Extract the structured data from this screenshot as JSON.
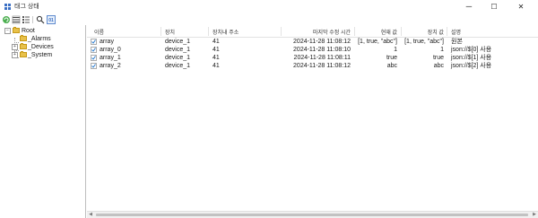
{
  "window": {
    "title": "태그 상태",
    "minimize": "─",
    "maximize": "☐",
    "close": "✕"
  },
  "toolbar": {
    "buttons": [
      "refresh-icon",
      "list-view-icon",
      "detail-view-icon",
      "search-icon",
      "binary-view-icon"
    ]
  },
  "tree": {
    "root": {
      "label": "Root",
      "expander": "−"
    },
    "children": [
      {
        "label": "_Alarms",
        "expander": ""
      },
      {
        "label": "_Devices",
        "expander": "+"
      },
      {
        "label": "_System",
        "expander": "+"
      }
    ]
  },
  "grid": {
    "columns": [
      "이름",
      "장치",
      "장치내 주소",
      "마지막 수정 시간",
      "현재 값",
      "장치 값",
      "설명"
    ],
    "rows": [
      {
        "name": "array",
        "device": "device_1",
        "address": "41",
        "modified": "2024-11-28 11:08:12",
        "current": "[1, true, \"abc\"]",
        "device_value": "[1, true, \"abc\"]",
        "description": "원본"
      },
      {
        "name": "array_0",
        "device": "device_1",
        "address": "41",
        "modified": "2024-11-28 11:08:10",
        "current": "1",
        "device_value": "1",
        "description": "json://$[0] 사용"
      },
      {
        "name": "array_1",
        "device": "device_1",
        "address": "41",
        "modified": "2024-11-28 11:08:11",
        "current": "true",
        "device_value": "true",
        "description": "json://$[1] 사용"
      },
      {
        "name": "array_2",
        "device": "device_1",
        "address": "41",
        "modified": "2024-11-28 11:08:12",
        "current": "abc",
        "device_value": "abc",
        "description": "json://$[2] 사용"
      }
    ]
  },
  "scrollbar": {
    "left": "◀",
    "right": "▶"
  },
  "colors": {
    "folder": "#e8c14a",
    "accent": "#3a6fc4",
    "tag_icon": "#2f7fd0"
  }
}
